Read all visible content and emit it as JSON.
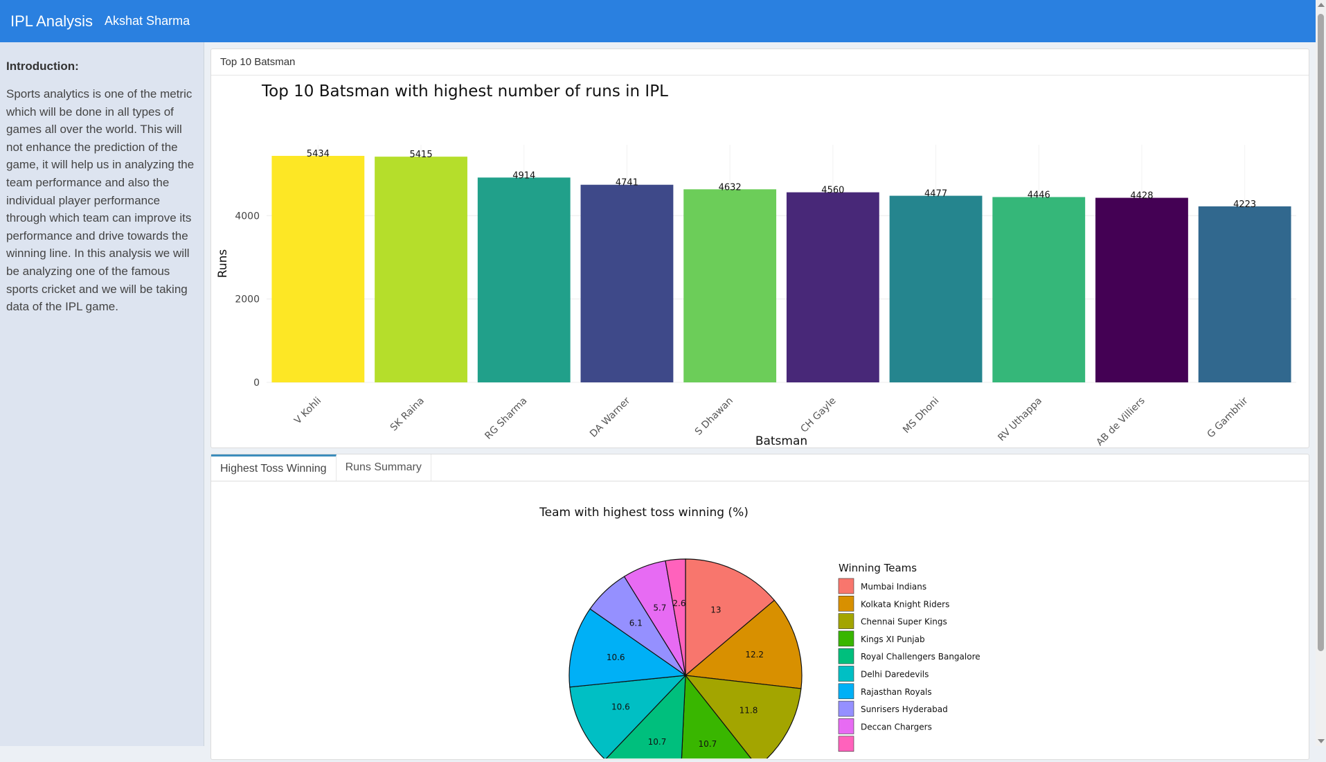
{
  "header": {
    "title": "IPL Analysis",
    "subtitle": "Akshat Sharma",
    "color": "#2a80e0"
  },
  "sidebar": {
    "heading": "Introduction:",
    "text": "Sports analytics is one of the metric which will be done in all types of games all over the world. This will not enhance the prediction of the game, it will help us in analyzing the team performance and also the individual player performance through which team can improve its performance and drive towards the winning line. In this analysis we will be analyzing one of the famous sports cricket and we will be taking data of the IPL game."
  },
  "panel1": {
    "header": "Top 10 Batsman"
  },
  "tabs": [
    {
      "label": "Highest Toss Winning",
      "active": true
    },
    {
      "label": "Runs Summary",
      "active": false
    }
  ],
  "chart_data": [
    {
      "type": "bar",
      "title": "Top 10 Batsman with highest number of runs in IPL",
      "xlabel": "Batsman",
      "ylabel": "Runs",
      "categories": [
        "V Kohli",
        "SK Raina",
        "RG Sharma",
        "DA Warner",
        "S Dhawan",
        "CH Gayle",
        "MS Dhoni",
        "RV Uthappa",
        "AB de Villiers",
        "G Gambhir"
      ],
      "values": [
        5434,
        5415,
        4914,
        4741,
        4632,
        4560,
        4477,
        4446,
        4428,
        4223
      ],
      "colors": [
        "#fde725",
        "#b5de2b",
        "#21a08a",
        "#3e4989",
        "#6ccd59",
        "#482878",
        "#25858e",
        "#35b779",
        "#440154",
        "#31688e"
      ],
      "yticks": [
        0,
        2000,
        4000
      ],
      "ylim": [
        0,
        5700
      ],
      "grid": true
    },
    {
      "type": "pie",
      "title": "Team with highest toss winning (%)",
      "legend_title": "Winning Teams",
      "legend_position": "right",
      "slices": [
        {
          "label": "Mumbai Indians",
          "value": 13,
          "color": "#f8766d"
        },
        {
          "label": "Kolkata Knight Riders",
          "value": 12.2,
          "color": "#d89000"
        },
        {
          "label": "Chennai Super Kings",
          "value": 11.8,
          "color": "#a3a500"
        },
        {
          "label": "Kings XI Punjab",
          "value": 10.7,
          "color": "#39b600"
        },
        {
          "label": "Royal Challengers Bangalore",
          "value": 10.7,
          "color": "#00bf7d"
        },
        {
          "label": "Delhi Daredevils",
          "value": 10.6,
          "color": "#00bfc4"
        },
        {
          "label": "Rajasthan Royals",
          "value": 10.6,
          "color": "#00b0f6"
        },
        {
          "label": "Sunrisers Hyderabad",
          "value": 6.1,
          "color": "#9590ff"
        },
        {
          "label": "Deccan Chargers",
          "value": 5.7,
          "color": "#e76bf3"
        },
        {
          "label": "",
          "value": 2.6,
          "color": "#ff62bc"
        }
      ],
      "slice_labels": [
        "13",
        "12.2",
        "11.8",
        "10.7",
        "10.7",
        "10.6",
        "10.6",
        "6.1",
        "5.7",
        "2.6"
      ]
    }
  ]
}
